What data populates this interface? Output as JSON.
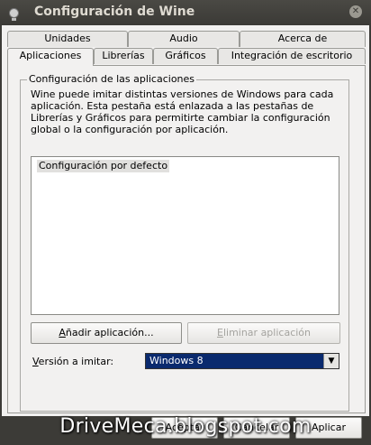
{
  "window": {
    "title": "Configuración de Wine"
  },
  "tabs_back": [
    "Unidades",
    "Audio",
    "Acerca de"
  ],
  "tabs_front": [
    "Aplicaciones",
    "Librerías",
    "Gráficos",
    "Integración de escritorio"
  ],
  "group": {
    "label": "Configuración de las aplicaciones",
    "description": "Wine puede imitar distintas versiones de Windows para cada aplicación. Esta pestaña está enlazada a las pestañas de Librerías y Gráficos para permitirte cambiar la configuración global o la configuración por aplicación.",
    "list_items": [
      "Configuración por defecto"
    ],
    "add_button": {
      "mnemonic": "A",
      "rest": "ñadir aplicación..."
    },
    "remove_button": {
      "mnemonic": "E",
      "rest": "liminar aplicación"
    },
    "version_label": {
      "mnemonic": "V",
      "rest": "ersión a imitar:"
    },
    "version_value": "Windows 8"
  },
  "buttons": {
    "accept": "Aceptar",
    "cancel": "Cancelar",
    "apply": "Aplicar"
  },
  "watermark": "DriveMeca.blogspot.com"
}
